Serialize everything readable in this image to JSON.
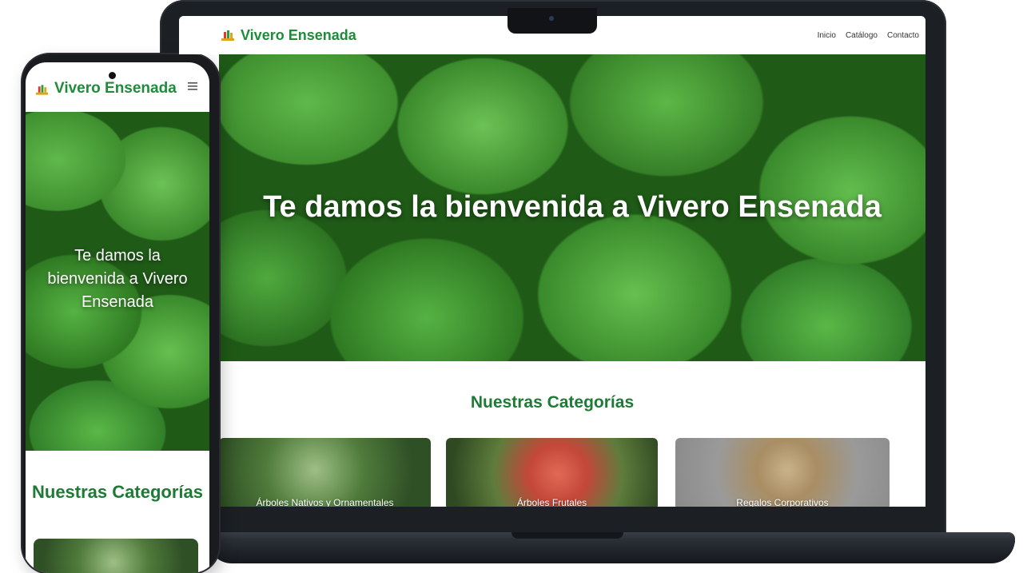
{
  "laptop": {
    "brand": "Vivero Ensenada",
    "nav": [
      "Inicio",
      "Catálogo",
      "Contacto"
    ],
    "hero_title": "Te damos la bienvenida a Vivero Ensenada",
    "section_title": "Nuestras Categorías",
    "categories": [
      "Árboles Nativos y Ornamentales",
      "Árboles Frutales",
      "Regalos Corporativos"
    ]
  },
  "phone": {
    "brand": "Vivero Ensenada",
    "hero_title": "Te damos la bienvenida a Vivero Ensenada",
    "section_title": "Nuestras Categorías"
  },
  "colors": {
    "brand_green": "#1e8c3a",
    "heading_green": "#1e7a34",
    "device_dark": "#1c1f24"
  },
  "icons": [
    "logo-icon",
    "hamburger-menu-icon"
  ]
}
